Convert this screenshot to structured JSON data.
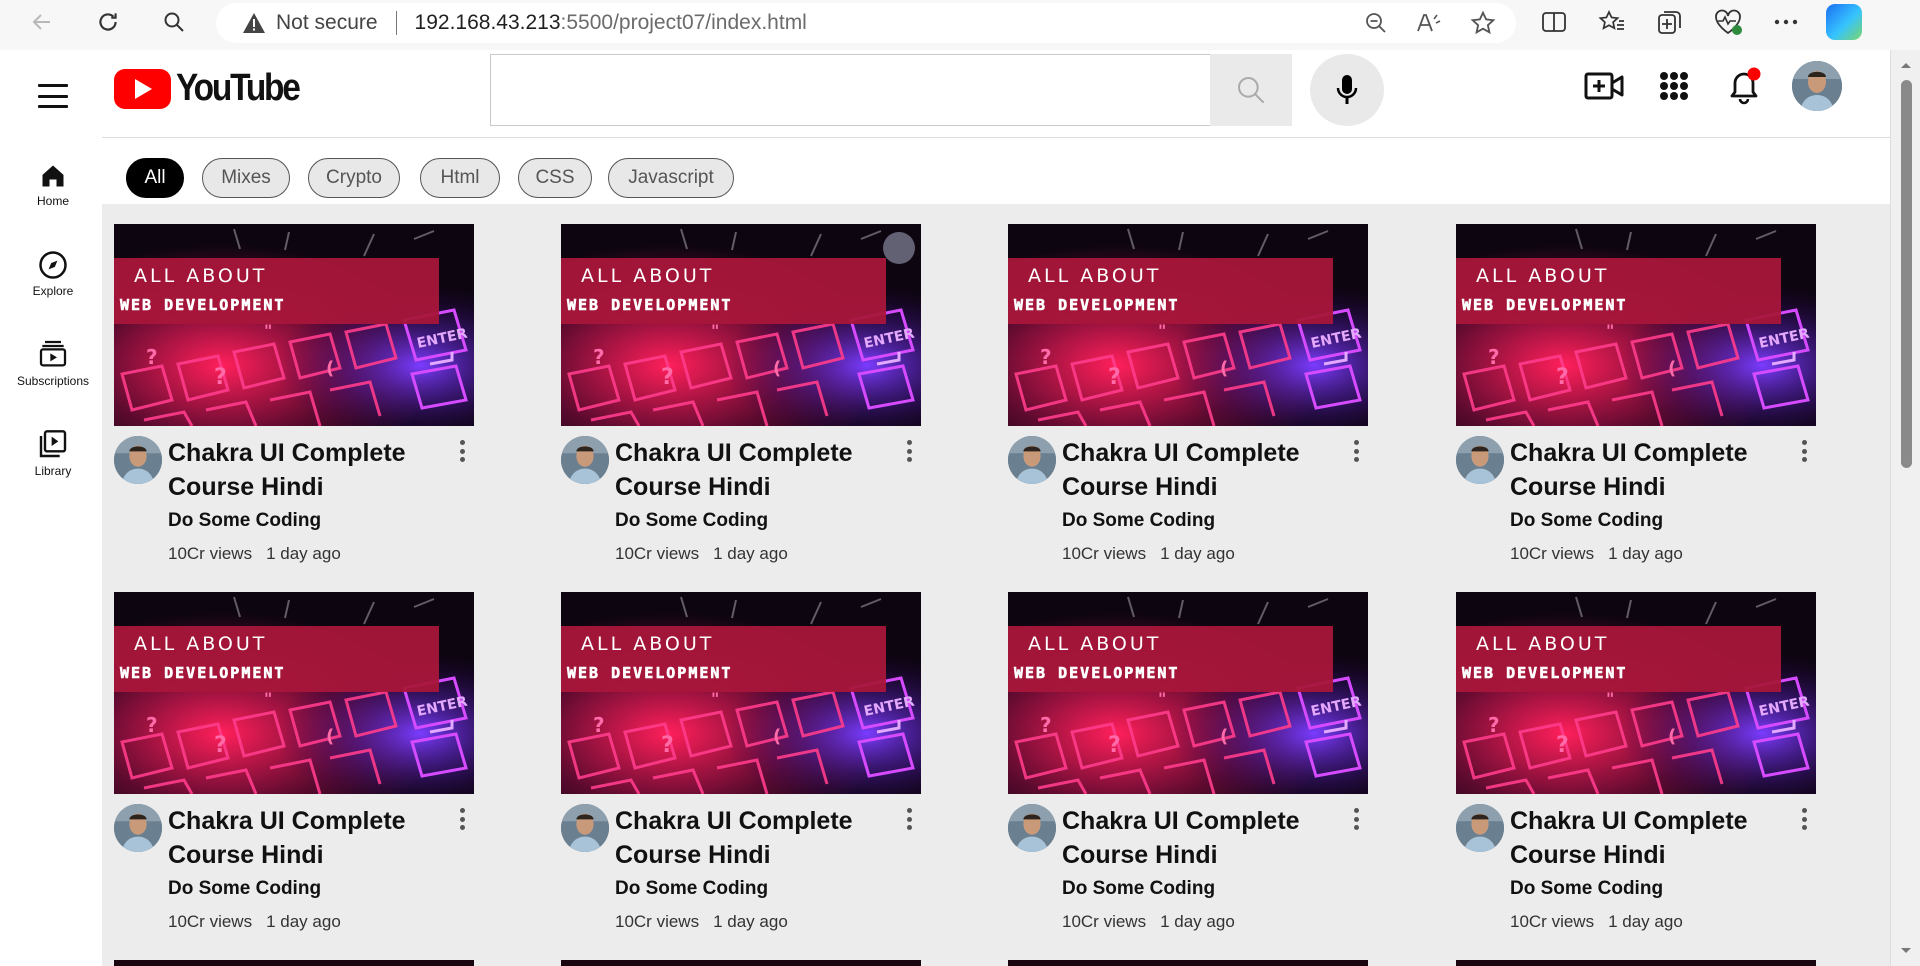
{
  "browser": {
    "security_label": "Not secure",
    "url_host": "192.168.43.213",
    "url_path": ":5500/project07/index.html"
  },
  "sidebar": {
    "items": [
      {
        "label": "Home",
        "icon": "home-icon"
      },
      {
        "label": "Explore",
        "icon": "compass-icon"
      },
      {
        "label": "Subscriptions",
        "icon": "subscriptions-icon"
      },
      {
        "label": "Library",
        "icon": "library-icon"
      }
    ]
  },
  "header": {
    "logo_text": "YouTube",
    "search_placeholder": ""
  },
  "chips": [
    {
      "label": "All",
      "active": true
    },
    {
      "label": "Mixes",
      "active": false
    },
    {
      "label": "Crypto",
      "active": false
    },
    {
      "label": "Html",
      "active": false
    },
    {
      "label": "CSS",
      "active": false
    },
    {
      "label": "Javascript",
      "active": false
    }
  ],
  "thumbnail": {
    "line1": "ALL ABOUT",
    "line2": "WEB DEVELOPMENT",
    "key_label": "ENTER"
  },
  "videos": [
    {
      "title": "Chakra UI Complete Course Hindi",
      "channel": "Do Some Coding",
      "views": "10Cr views",
      "age": "1 day ago"
    },
    {
      "title": "Chakra UI Complete Course Hindi",
      "channel": "Do Some Coding",
      "views": "10Cr views",
      "age": "1 day ago"
    },
    {
      "title": "Chakra UI Complete Course Hindi",
      "channel": "Do Some Coding",
      "views": "10Cr views",
      "age": "1 day ago"
    },
    {
      "title": "Chakra UI Complete Course Hindi",
      "channel": "Do Some Coding",
      "views": "10Cr views",
      "age": "1 day ago"
    },
    {
      "title": "Chakra UI Complete Course Hindi",
      "channel": "Do Some Coding",
      "views": "10Cr views",
      "age": "1 day ago"
    },
    {
      "title": "Chakra UI Complete Course Hindi",
      "channel": "Do Some Coding",
      "views": "10Cr views",
      "age": "1 day ago"
    },
    {
      "title": "Chakra UI Complete Course Hindi",
      "channel": "Do Some Coding",
      "views": "10Cr views",
      "age": "1 day ago"
    },
    {
      "title": "Chakra UI Complete Course Hindi",
      "channel": "Do Some Coding",
      "views": "10Cr views",
      "age": "1 day ago"
    }
  ],
  "colors": {
    "brand_red": "#ff0000",
    "banner_red": "#a8163a",
    "content_bg": "#ececec",
    "notification_dot": "#ff0000"
  }
}
